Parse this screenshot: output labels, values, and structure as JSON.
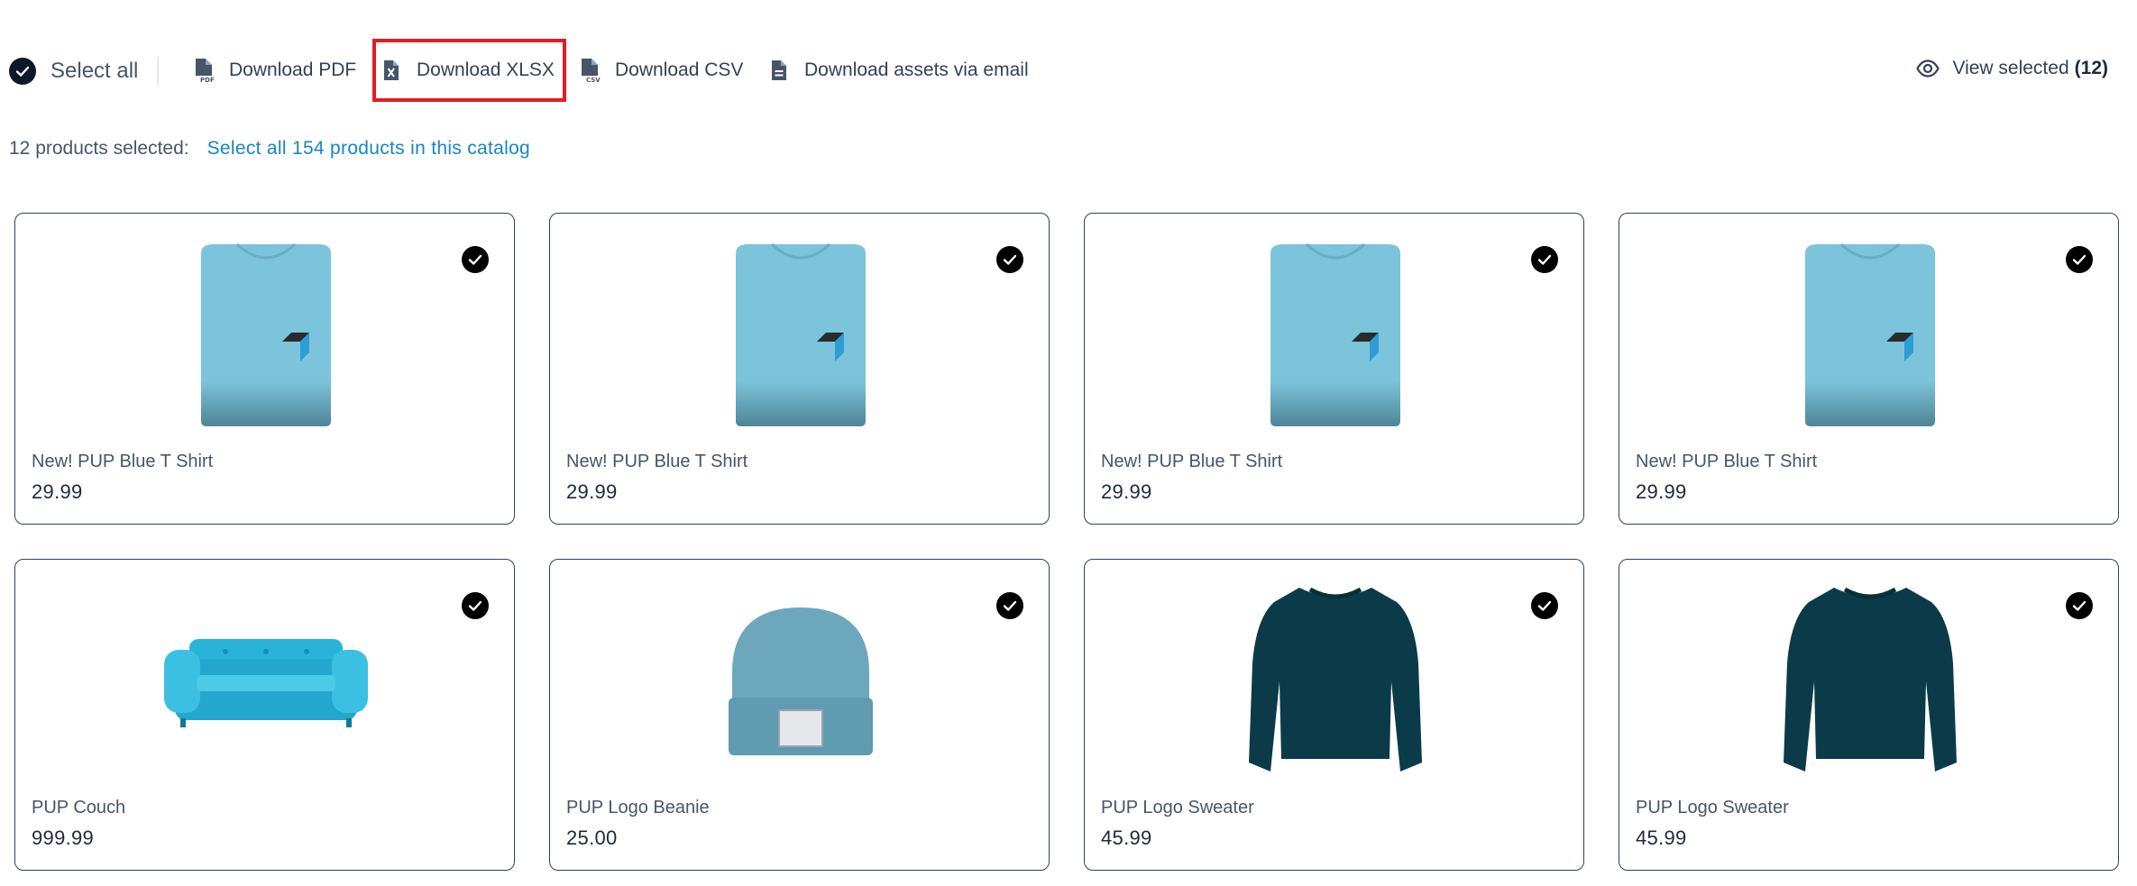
{
  "toolbar": {
    "select_all": "Select all",
    "download_pdf": "Download PDF",
    "download_xlsx": "Download XLSX",
    "download_csv": "Download CSV",
    "download_email": "Download assets via email",
    "view_selected": "View selected",
    "view_selected_count": "(12)"
  },
  "selection": {
    "count_text": "12 products selected:",
    "select_catalog": "Select all 154 products in this catalog"
  },
  "products": [
    {
      "name": "New! PUP Blue T Shirt",
      "price": "29.99",
      "image": "tshirt"
    },
    {
      "name": "New! PUP Blue T Shirt",
      "price": "29.99",
      "image": "tshirt"
    },
    {
      "name": "New! PUP Blue T Shirt",
      "price": "29.99",
      "image": "tshirt"
    },
    {
      "name": "New! PUP Blue T Shirt",
      "price": "29.99",
      "image": "tshirt"
    },
    {
      "name": "PUP Couch",
      "price": "999.99",
      "image": "couch"
    },
    {
      "name": "PUP Logo Beanie",
      "price": "25.00",
      "image": "beanie"
    },
    {
      "name": "PUP Logo Sweater",
      "price": "45.99",
      "image": "sweater"
    },
    {
      "name": "PUP Logo Sweater",
      "price": "45.99",
      "image": "sweater"
    }
  ],
  "colors": {
    "accent_link": "#1686c6",
    "highlight_box": "#e11d23",
    "tshirt": "#7cc4dc",
    "couch": "#29b3d9",
    "beanie": "#6da7bd",
    "sweater": "#0b3b48"
  }
}
